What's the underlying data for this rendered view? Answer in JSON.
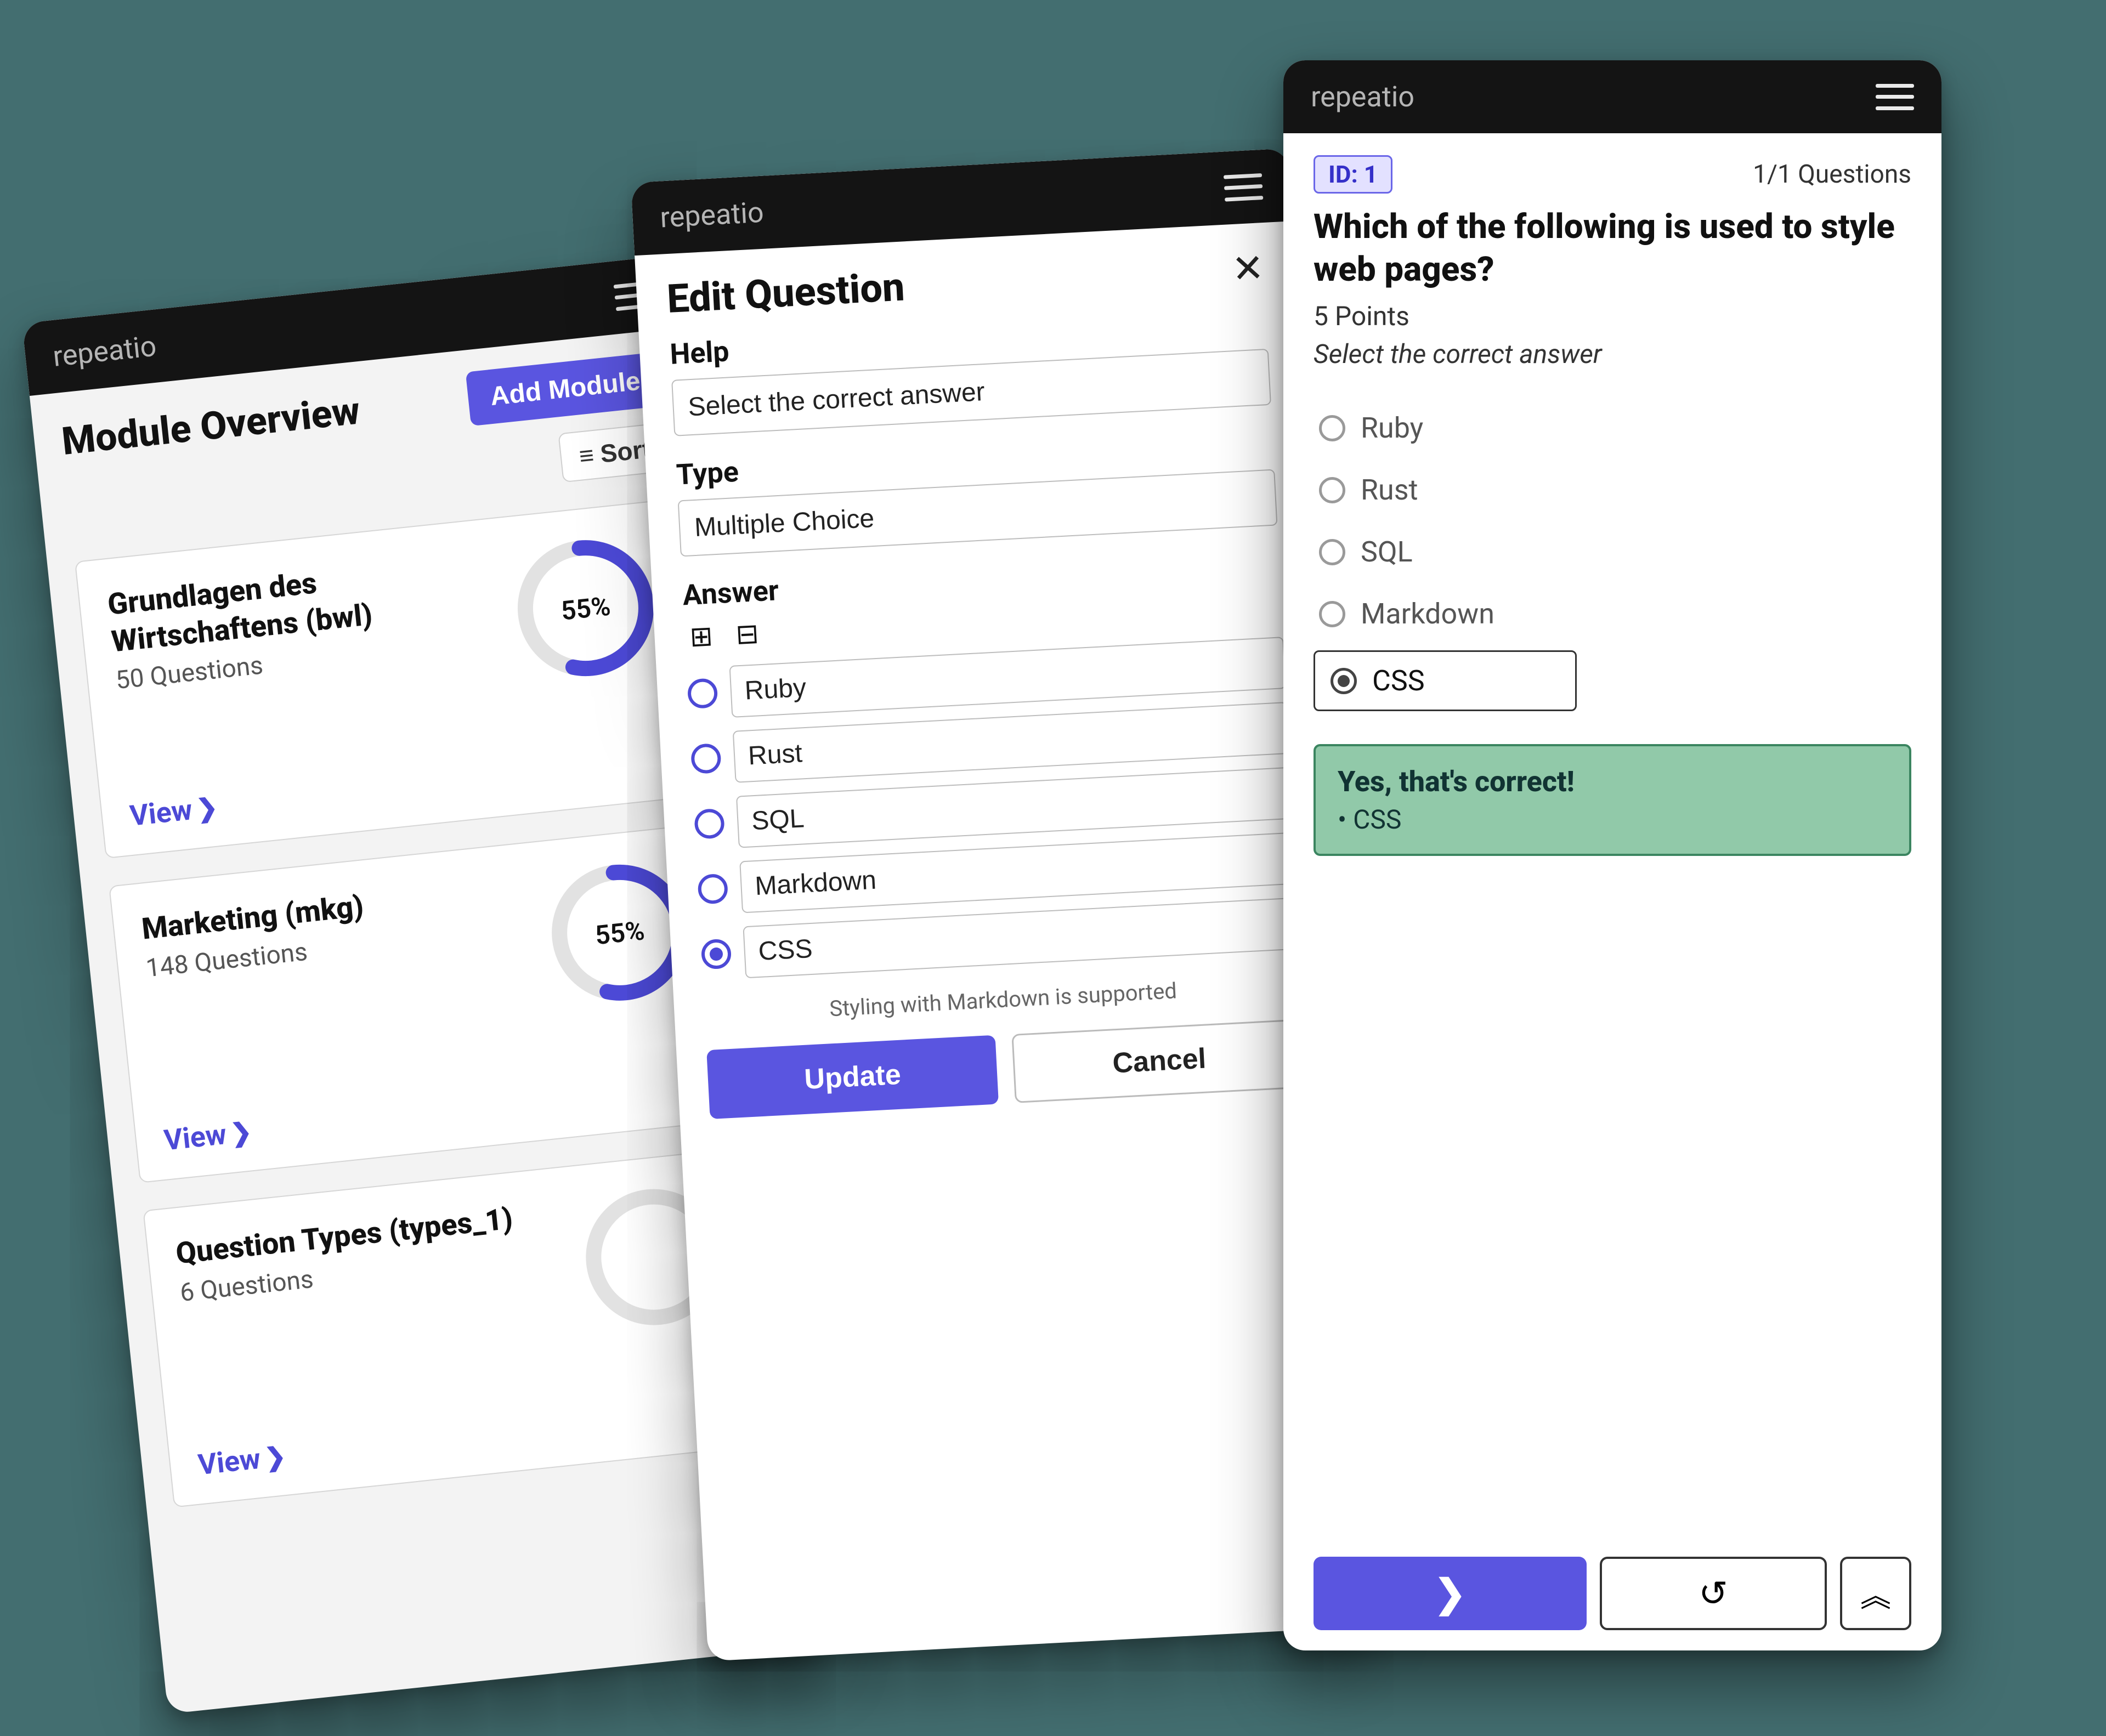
{
  "app_name": "repeatio",
  "accent_color": "#5a55e0",
  "overview": {
    "title": "Module Overview",
    "add_button": "Add Module",
    "sort_label": "Sort",
    "sort_prefix": "≡",
    "view_label": "View",
    "modules": [
      {
        "name": "Grundlagen des Wirtschaftens (bwl)",
        "questions": "50 Questions",
        "progress_pct": "55%",
        "progress_val": 55
      },
      {
        "name": "Marketing (mkg)",
        "questions": "148 Questions",
        "progress_pct": "55%",
        "progress_val": 55
      },
      {
        "name": "Question Types (types_1)",
        "questions": "6 Questions",
        "progress_pct": "",
        "progress_val": 0
      }
    ]
  },
  "editor": {
    "title": "Edit Question",
    "fields": {
      "help_label": "Help",
      "help_value": "Select the correct answer",
      "type_label": "Type",
      "type_value": "Multiple Choice",
      "answer_label": "Answer"
    },
    "answers": [
      "Ruby",
      "Rust",
      "SQL",
      "Markdown",
      "CSS"
    ],
    "correct_index": 4,
    "hint": "Styling with Markdown is supported",
    "update_btn": "Update",
    "cancel_btn": "Cancel"
  },
  "quiz": {
    "id_badge": "ID: 1",
    "counter": "1/1 Questions",
    "question": "Which of the following is used to style web pages?",
    "points": "5 Points",
    "help_text": "Select the correct answer",
    "options": [
      "Ruby",
      "Rust",
      "SQL",
      "Markdown",
      "CSS"
    ],
    "selected_index": 4,
    "feedback_title": "Yes, that's correct!",
    "feedback_item": "CSS",
    "feedback_color": "#91c9a9"
  }
}
